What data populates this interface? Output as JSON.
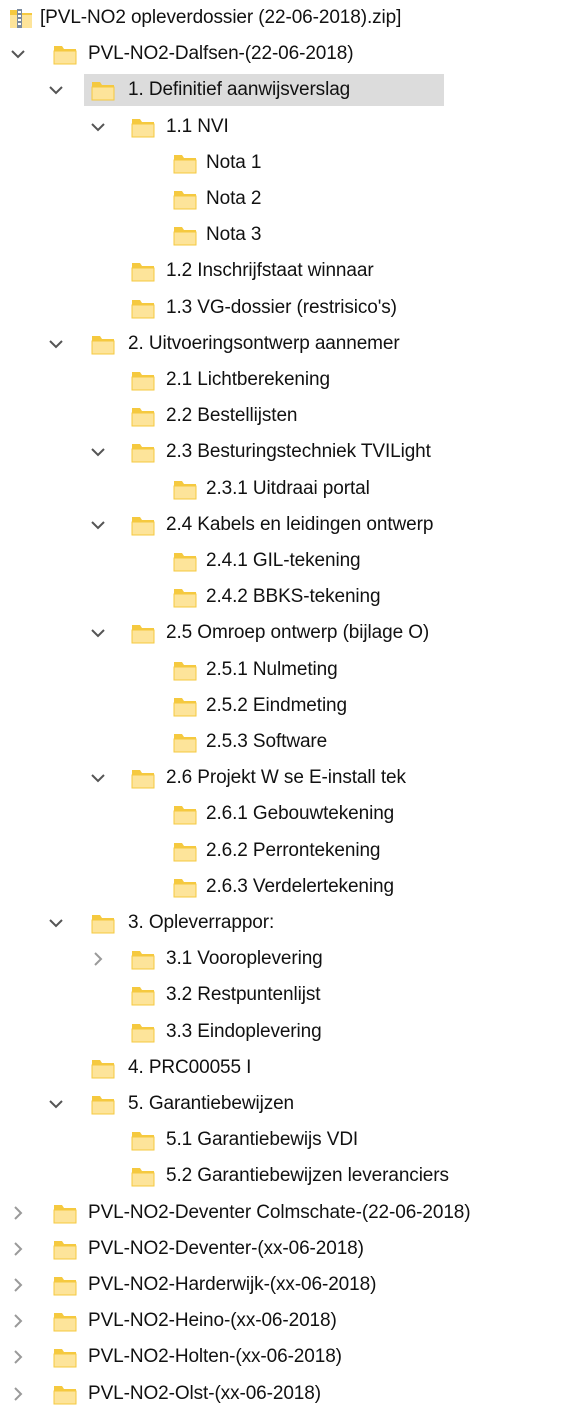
{
  "tree": {
    "items": [
      {
        "level": 0,
        "icon": "zip-archive-icon",
        "chevron": "none",
        "label": "[PVL-NO2 opleverdossier (22-06-2018).zip]"
      },
      {
        "level": 1,
        "icon": "folder-icon",
        "chevron": "expanded",
        "label": "PVL-NO2-Dalfsen-(22-06-2018)"
      },
      {
        "level": 2,
        "icon": "folder-icon",
        "chevron": "expanded",
        "label": "1. Definitief aanwijsverslag",
        "selected": true
      },
      {
        "level": 3,
        "icon": "folder-icon",
        "chevron": "expanded",
        "label": "1.1 NVI"
      },
      {
        "level": 4,
        "icon": "folder-icon",
        "chevron": "none",
        "label": "Nota 1"
      },
      {
        "level": 4,
        "icon": "folder-icon",
        "chevron": "none",
        "label": "Nota 2"
      },
      {
        "level": 4,
        "icon": "folder-icon",
        "chevron": "none",
        "label": "Nota 3"
      },
      {
        "level": 3,
        "icon": "folder-icon",
        "chevron": "none",
        "label": "1.2 Inschrijfstaat winnaar"
      },
      {
        "level": 3,
        "icon": "folder-icon",
        "chevron": "none",
        "label": "1.3 VG-dossier (restrisico's)"
      },
      {
        "level": 2,
        "icon": "folder-icon",
        "chevron": "expanded",
        "label": "2. Uitvoeringsontwerp aannemer"
      },
      {
        "level": 3,
        "icon": "folder-icon",
        "chevron": "none",
        "label": "2.1 Lichtberekening"
      },
      {
        "level": 3,
        "icon": "folder-icon",
        "chevron": "none",
        "label": "2.2 Bestellijsten"
      },
      {
        "level": 3,
        "icon": "folder-icon",
        "chevron": "expanded",
        "label": "2.3 Besturingstechniek TVILight"
      },
      {
        "level": 4,
        "icon": "folder-icon",
        "chevron": "none",
        "label": "2.3.1 Uitdraai portal"
      },
      {
        "level": 3,
        "icon": "folder-icon",
        "chevron": "expanded",
        "label": "2.4 Kabels en leidingen ontwerp"
      },
      {
        "level": 4,
        "icon": "folder-icon",
        "chevron": "none",
        "label": "2.4.1 GIL-tekening"
      },
      {
        "level": 4,
        "icon": "folder-icon",
        "chevron": "none",
        "label": "2.4.2 BBKS-tekening"
      },
      {
        "level": 3,
        "icon": "folder-icon",
        "chevron": "expanded",
        "label": "2.5 Omroep ontwerp (bijlage O)"
      },
      {
        "level": 4,
        "icon": "folder-icon",
        "chevron": "none",
        "label": "2.5.1 Nulmeting"
      },
      {
        "level": 4,
        "icon": "folder-icon",
        "chevron": "none",
        "label": "2.5.2 Eindmeting"
      },
      {
        "level": 4,
        "icon": "folder-icon",
        "chevron": "none",
        "label": "2.5.3 Software"
      },
      {
        "level": 3,
        "icon": "folder-icon",
        "chevron": "expanded",
        "label": "2.6 Projekt W se E-install tek"
      },
      {
        "level": 4,
        "icon": "folder-icon",
        "chevron": "none",
        "label": "2.6.1 Gebouwtekening"
      },
      {
        "level": 4,
        "icon": "folder-icon",
        "chevron": "none",
        "label": "2.6.2 Perrontekening"
      },
      {
        "level": 4,
        "icon": "folder-icon",
        "chevron": "none",
        "label": "2.6.3 Verdelertekening"
      },
      {
        "level": 2,
        "icon": "folder-icon",
        "chevron": "expanded",
        "label": "3. Opleverrappor:"
      },
      {
        "level": 3,
        "icon": "folder-icon",
        "chevron": "collapsed",
        "label": "3.1 Vooroplevering"
      },
      {
        "level": 3,
        "icon": "folder-icon",
        "chevron": "none",
        "label": "3.2 Restpuntenlijst"
      },
      {
        "level": 3,
        "icon": "folder-icon",
        "chevron": "none",
        "label": "3.3 Eindoplevering"
      },
      {
        "level": 2,
        "icon": "folder-icon",
        "chevron": "none",
        "label": "4. PRC00055 I"
      },
      {
        "level": 2,
        "icon": "folder-icon",
        "chevron": "expanded",
        "label": "5. Garantiebewijzen"
      },
      {
        "level": 3,
        "icon": "folder-icon",
        "chevron": "none",
        "label": "5.1 Garantiebewijs VDI"
      },
      {
        "level": 3,
        "icon": "folder-icon",
        "chevron": "none",
        "label": "5.2 Garantiebewijzen leveranciers"
      },
      {
        "level": 1,
        "icon": "folder-icon",
        "chevron": "collapsed",
        "label": "PVL-NO2-Deventer Colmschate-(22-06-2018)"
      },
      {
        "level": 1,
        "icon": "folder-icon",
        "chevron": "collapsed",
        "label": "PVL-NO2-Deventer-(xx-06-2018)"
      },
      {
        "level": 1,
        "icon": "folder-icon",
        "chevron": "collapsed",
        "label": "PVL-NO2-Harderwijk-(xx-06-2018)"
      },
      {
        "level": 1,
        "icon": "folder-icon",
        "chevron": "collapsed",
        "label": "PVL-NO2-Heino-(xx-06-2018)"
      },
      {
        "level": 1,
        "icon": "folder-icon",
        "chevron": "collapsed",
        "label": "PVL-NO2-Holten-(xx-06-2018)"
      },
      {
        "level": 1,
        "icon": "folder-icon",
        "chevron": "collapsed",
        "label": "PVL-NO2-Olst-(xx-06-2018)"
      }
    ]
  },
  "colors": {
    "folder": "#f5c93f",
    "folder_light": "#fde49a",
    "chevron": "#555555",
    "chevron_collapsed": "#9a9a9a",
    "selection": "#dcdcdc"
  }
}
